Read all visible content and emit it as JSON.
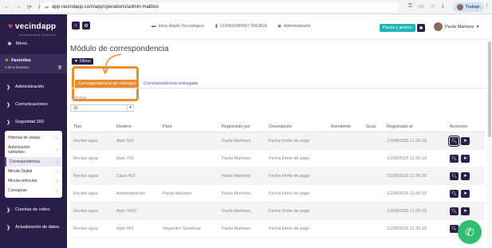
{
  "browser": {
    "url": "app.vecindapp.co/#/app/operations/admin-mailbox",
    "profile": "Trabajo"
  },
  "sidebar": {
    "logo_text": "vecindapp",
    "logo_sub": "COMUNIDAD DIGITAL",
    "menu_label": "Menú",
    "favorites_label": "Favoritos",
    "favorites_count": "0 de 5 favoritos",
    "sections": [
      {
        "label": "Administración"
      },
      {
        "label": "Comunicaciones"
      },
      {
        "label": "Seguridad 360"
      }
    ],
    "submenu": [
      {
        "label": "Historial de visitas"
      },
      {
        "label": "Autorización visitantes"
      },
      {
        "label": "Correspondencia"
      },
      {
        "label": "Minuta Digital"
      },
      {
        "label": "Minuta vehicular"
      },
      {
        "label": "Consignas"
      }
    ],
    "bottom_sections": [
      {
        "label": "Cuentas de cobro"
      },
      {
        "label": "Actualización de datos"
      }
    ]
  },
  "topbar": {
    "company": "Intus Alado Tecnológico",
    "condo": "CONDOMINIO TREBOL",
    "role": "Administrador",
    "plans_label": "Planes y precios",
    "user_name": "Paola Martinez"
  },
  "main": {
    "title": "Módulo de correspondencia",
    "filter_label": "Filtros",
    "tabs": [
      {
        "label": "Correspondencia sin entregar"
      },
      {
        "label": "Correspondencia entregada"
      }
    ],
    "show_label": "Mostrar",
    "page_size": "10"
  },
  "table": {
    "headers": [
      "Tipo",
      "Destino",
      "Para",
      "Registrado por",
      "Descripción",
      "Remitente",
      "Guía",
      "Registrado el",
      "Acciones"
    ],
    "rows": [
      {
        "tipo": "Recibo agua",
        "destino": "Apto 501",
        "para": "",
        "registrado_por": "Paola Martinez",
        "descripcion": "Fecha límite de pago",
        "remitente": "",
        "guia": "",
        "fecha": "12/08/2025 11:35:18"
      },
      {
        "tipo": "Recibo agua",
        "destino": "Apto 702",
        "para": "",
        "registrado_por": "Paola Martinez",
        "descripcion": "Fecha límite de pago",
        "remitente": "",
        "guia": "",
        "fecha": "12/08/2025 11:35:18"
      },
      {
        "tipo": "Recibo agua",
        "destino": "Casa 401",
        "para": "",
        "registrado_por": "Paola Martinez",
        "descripcion": "Fecha límite de pago",
        "remitente": "",
        "guia": "",
        "fecha": "12/08/2025 11:35:18"
      },
      {
        "tipo": "Recibo agua",
        "destino": "Administración",
        "para": "Paola Martinez",
        "registrado_por": "Paola Martinez",
        "descripcion": "Fecha límite de pago",
        "remitente": "",
        "guia": "",
        "fecha": "12/08/2025 11:35:18"
      },
      {
        "tipo": "Recibo agua",
        "destino": "Apto 1002",
        "para": "",
        "registrado_por": "Paola Martinez",
        "descripcion": "Fecha límite de pago",
        "remitente": "",
        "guia": "",
        "fecha": "12/08/2025 11:35:18"
      },
      {
        "tipo": "Recibo agua",
        "destino": "Apto 401",
        "para": "Alejandro Sandoval",
        "registrado_por": "Paola Martinez",
        "descripcion": "Fecha límite de pago",
        "remitente": "",
        "guia": "",
        "fecha": "12/08/2025 11:35:18"
      }
    ]
  },
  "colors": {
    "sidebar_bg": "#2b1f4a",
    "accent_orange": "#f28c28",
    "teal": "#1db5b5",
    "whatsapp_green": "#2fbf71"
  }
}
